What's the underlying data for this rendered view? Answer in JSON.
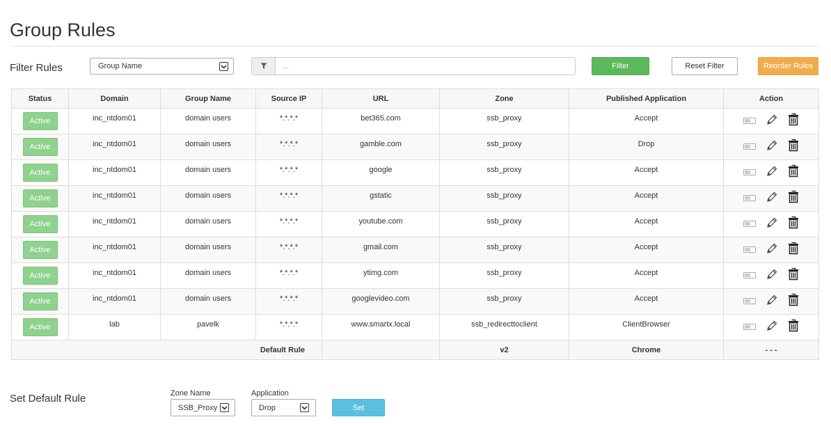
{
  "page": {
    "title": "Group Rules"
  },
  "filter": {
    "label": "Filter Rules",
    "field_value": "Group Name",
    "search_placeholder": "...",
    "filter_label": "Filter",
    "reset_label": "Reset Filter",
    "reorder_label": "Reorder Rules"
  },
  "table": {
    "headers": [
      "Status",
      "Domain",
      "Group Name",
      "Source IP",
      "URL",
      "Zone",
      "Published Application",
      "Action"
    ],
    "rows": [
      {
        "status": "Active",
        "domain": "inc_ntdom01",
        "group": "domain users",
        "source_ip": "*.*.*.*",
        "url": "bet365.com",
        "zone": "ssb_proxy",
        "app": "Accept"
      },
      {
        "status": "Active",
        "domain": "inc_ntdom01",
        "group": "domain users",
        "source_ip": "*.*.*.*",
        "url": "gamble.com",
        "zone": "ssb_proxy",
        "app": "Drop"
      },
      {
        "status": "Active",
        "domain": "inc_ntdom01",
        "group": "domain users",
        "source_ip": "*.*.*.*",
        "url": "google",
        "zone": "ssb_proxy",
        "app": "Accept"
      },
      {
        "status": "Active",
        "domain": "inc_ntdom01",
        "group": "domain users",
        "source_ip": "*.*.*.*",
        "url": "gstatic",
        "zone": "ssb_proxy",
        "app": "Accept"
      },
      {
        "status": "Active",
        "domain": "inc_ntdom01",
        "group": "domain users",
        "source_ip": "*.*.*.*",
        "url": "youtube.com",
        "zone": "ssb_proxy",
        "app": "Accept"
      },
      {
        "status": "Active",
        "domain": "inc_ntdom01",
        "group": "domain users",
        "source_ip": "*.*.*.*",
        "url": "gmail.com",
        "zone": "ssb_proxy",
        "app": "Accept"
      },
      {
        "status": "Active",
        "domain": "inc_ntdom01",
        "group": "domain users",
        "source_ip": "*.*.*.*",
        "url": "ytimg.com",
        "zone": "ssb_proxy",
        "app": "Accept"
      },
      {
        "status": "Active",
        "domain": "inc_ntdom01",
        "group": "domain users",
        "source_ip": "*.*.*.*",
        "url": "googlevideo.com",
        "zone": "ssb_proxy",
        "app": "Accept"
      },
      {
        "status": "Active",
        "domain": "lab",
        "group": "pavelk",
        "source_ip": "*.*.*.*",
        "url": "www.smartx.local",
        "zone": "ssb_redirecttoclient",
        "app": "ClientBrowser"
      }
    ],
    "default_row": {
      "label": "Default Rule",
      "zone": "v2",
      "app": "Chrome",
      "action": "- - -"
    }
  },
  "set_default": {
    "label": "Set Default Rule",
    "zone_label": "Zone Name",
    "zone_value": "SSB_Proxy",
    "app_label": "Application",
    "app_value": "Drop",
    "set_label": "Set"
  },
  "icons": {
    "toggle": "toggle-icon",
    "edit": "pencil-icon",
    "delete": "trash-icon",
    "filter": "funnel-icon",
    "dropdown": "chevron-down-icon"
  },
  "colors": {
    "filter": "#5cb85c",
    "reorder": "#f0ad4e",
    "active": "#8fd18f",
    "set": "#5bc0de"
  }
}
